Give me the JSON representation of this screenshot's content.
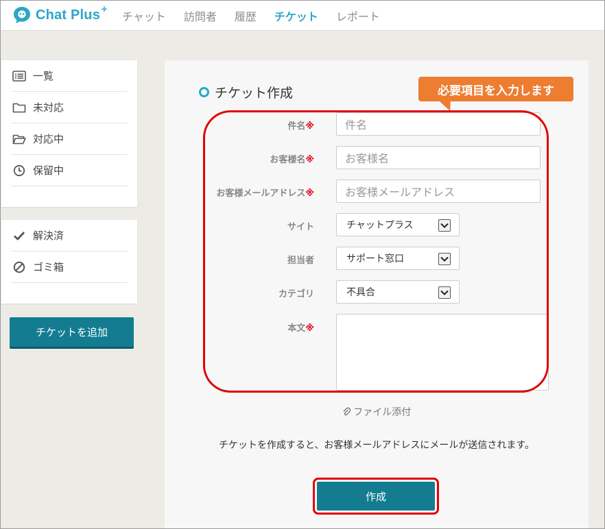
{
  "brand": {
    "name": "Chat Plus",
    "sup": "+"
  },
  "nav": [
    {
      "label": "チャット",
      "active": false
    },
    {
      "label": "訪問者",
      "active": false
    },
    {
      "label": "履歴",
      "active": false
    },
    {
      "label": "チケット",
      "active": true
    },
    {
      "label": "レポート",
      "active": false
    }
  ],
  "sidebar": {
    "group1": [
      {
        "label": "一覧",
        "icon": "list-icon"
      },
      {
        "label": "未対応",
        "icon": "folder-icon"
      },
      {
        "label": "対応中",
        "icon": "folder-open-icon"
      },
      {
        "label": "保留中",
        "icon": "clock-icon"
      }
    ],
    "group2": [
      {
        "label": "解決済",
        "icon": "check-icon"
      },
      {
        "label": "ゴミ箱",
        "icon": "ban-icon"
      }
    ],
    "add_ticket_label": "チケットを追加"
  },
  "form": {
    "title": "チケット作成",
    "callout": "必要項目を入力します",
    "required_mark": "※",
    "subject": {
      "label": "件名",
      "placeholder": "件名"
    },
    "customer_name": {
      "label": "お客様名",
      "placeholder": "お客様名"
    },
    "customer_email": {
      "label": "お客様メールアドレス",
      "placeholder": "お客様メールアドレス"
    },
    "site": {
      "label": "サイト",
      "value": "チャットプラス"
    },
    "assignee": {
      "label": "担当者",
      "value": "サポート窓口"
    },
    "category": {
      "label": "カテゴリ",
      "value": "不具合"
    },
    "body": {
      "label": "本文"
    },
    "attach_label": "ファイル添付",
    "notice": "チケットを作成すると、お客様メールアドレスにメールが送信されます。",
    "submit_label": "作成"
  },
  "colors": {
    "accent": "#2ba6c6",
    "button": "#137c91",
    "callout": "#ed7d31",
    "highlight": "#e00000"
  }
}
